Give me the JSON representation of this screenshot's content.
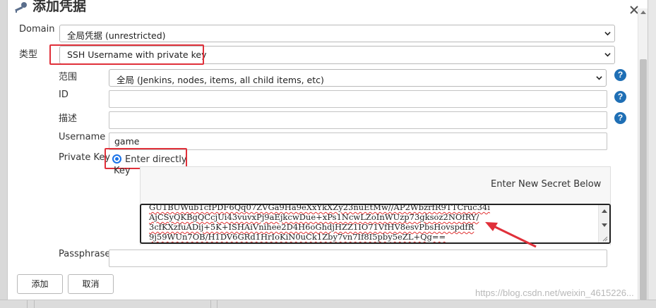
{
  "dialog": {
    "title": "添加凭据"
  },
  "form": {
    "domain_label": "Domain",
    "domain_value": "全局凭据 (unrestricted)",
    "kind_label": "类型",
    "kind_value": "SSH Username with private key",
    "scope_label": "范围",
    "scope_value": "全局 (Jenkins, nodes, items, all child items, etc)",
    "id_label": "ID",
    "id_value": "",
    "description_label": "描述",
    "description_value": "",
    "username_label": "Username",
    "username_value": "game",
    "private_key_label": "Private Key",
    "enter_directly_label": "Enter directly",
    "key_label": "Key",
    "enter_secret_hint": "Enter New Secret Below",
    "key_lines": [
      "GU1BUWub1cfPDF6Qq07ZVGa9Ha9eXxYkXZy23nuEtMw//AP2WbzrfR9TTCruc34i",
      "AjCSyQKBgQCcjUi43vuvxPj9aEjkcwDue+xPs1NcwLZoInWUzp73gksoz2NOfRY/",
      "3cfKXzfuADij+5K+ISHAiVnihee2D4H6oGhdjHZZ1IO71VfHV8esvPbsHovspdfR",
      "9j59WUn7OB/H1DV6GRd1HrIoKiN0uCk1Zby7vn7If8I5pby5eZL+Qg=="
    ],
    "passphrase_label": "Passphrase",
    "passphrase_value": ""
  },
  "buttons": {
    "add": "添加",
    "cancel": "取消"
  },
  "help_glyph": "?",
  "watermark": "https://blog.csdn.net/weixin_4615226...",
  "colors": {
    "accent": "#1f6fb5",
    "highlight": "#e0303a",
    "arrow": "#e0303a"
  }
}
